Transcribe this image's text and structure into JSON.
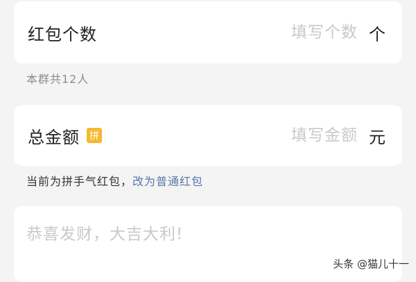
{
  "count_card": {
    "label": "红包个数",
    "placeholder": "填写个数",
    "value": "",
    "unit": "个"
  },
  "members_hint": "本群共12人",
  "amount_card": {
    "label": "总金额",
    "badge": "拼",
    "placeholder": "填写金额",
    "value": "",
    "unit": "元"
  },
  "mode_hint": {
    "text": "当前为拼手气红包，",
    "link": "改为普通红包"
  },
  "greeting": {
    "placeholder": "恭喜发财，大吉大利!",
    "value": ""
  },
  "watermark": "头条 @猫儿十一",
  "colors": {
    "background": "#f4f4f4",
    "card": "#ffffff",
    "badge": "#f5b82e",
    "link": "#5b78a8",
    "placeholder": "#c9c9c9"
  }
}
